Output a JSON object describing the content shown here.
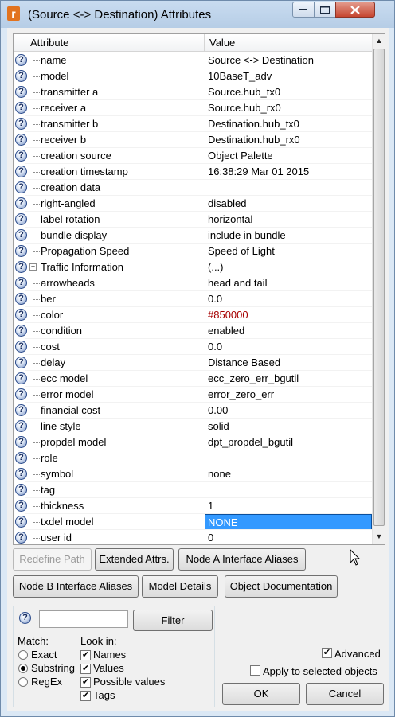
{
  "window": {
    "title": "(Source <-> Destination) Attributes",
    "app_icon": "r"
  },
  "table": {
    "headers": {
      "attribute": "Attribute",
      "value": "Value"
    },
    "rows": [
      {
        "attr": "name",
        "value": "Source <-> Destination"
      },
      {
        "attr": "model",
        "value": "10BaseT_adv"
      },
      {
        "attr": "transmitter a",
        "value": "Source.hub_tx0"
      },
      {
        "attr": "receiver a",
        "value": "Source.hub_rx0"
      },
      {
        "attr": "transmitter b",
        "value": "Destination.hub_tx0"
      },
      {
        "attr": "receiver b",
        "value": "Destination.hub_rx0"
      },
      {
        "attr": "creation source",
        "value": "Object Palette"
      },
      {
        "attr": "creation timestamp",
        "value": "16:38:29 Mar 01 2015"
      },
      {
        "attr": "creation data",
        "value": ""
      },
      {
        "attr": "right-angled",
        "value": "disabled"
      },
      {
        "attr": "label rotation",
        "value": "horizontal"
      },
      {
        "attr": "bundle display",
        "value": "include in bundle"
      },
      {
        "attr": "Propagation Speed",
        "value": "Speed of Light"
      },
      {
        "attr": "Traffic Information",
        "value": "(...)",
        "expandable": true
      },
      {
        "attr": "arrowheads",
        "value": "head and tail"
      },
      {
        "attr": "ber",
        "value": "0.0"
      },
      {
        "attr": "color",
        "value": "#850000",
        "value_color": "#a60000"
      },
      {
        "attr": "condition",
        "value": "enabled"
      },
      {
        "attr": "cost",
        "value": "0.0"
      },
      {
        "attr": "delay",
        "value": "Distance Based"
      },
      {
        "attr": "ecc model",
        "value": "ecc_zero_err_bgutil"
      },
      {
        "attr": "error model",
        "value": "error_zero_err"
      },
      {
        "attr": "financial cost",
        "value": "0.00"
      },
      {
        "attr": "line style",
        "value": "solid"
      },
      {
        "attr": "propdel model",
        "value": "dpt_propdel_bgutil"
      },
      {
        "attr": "role",
        "value": ""
      },
      {
        "attr": "symbol",
        "value": "none"
      },
      {
        "attr": "tag",
        "value": ""
      },
      {
        "attr": "thickness",
        "value": "1"
      },
      {
        "attr": "txdel model",
        "value": "NONE",
        "selected": true
      },
      {
        "attr": "user id",
        "value": "0"
      }
    ],
    "help_icon": "?",
    "expander_icon": "+"
  },
  "buttons": {
    "redefine_path": "Redefine Path",
    "extended_attrs": "Extended Attrs.",
    "node_a_aliases": "Node A Interface Aliases",
    "node_b_aliases": "Node B Interface Aliases",
    "model_details": "Model Details",
    "object_documentation": "Object Documentation",
    "ok": "OK",
    "cancel": "Cancel"
  },
  "filter": {
    "input_value": "",
    "button": "Filter",
    "match_label": "Match:",
    "match_options": [
      "Exact",
      "Substring",
      "RegEx"
    ],
    "match_selected": "Substring",
    "look_in_label": "Look in:",
    "look_in_options": [
      "Names",
      "Values",
      "Possible values",
      "Tags"
    ]
  },
  "options": {
    "advanced": "Advanced",
    "advanced_checked": true,
    "apply_selected": "Apply to selected objects",
    "apply_selected_checked": false
  },
  "accent_color": "#3399ff"
}
